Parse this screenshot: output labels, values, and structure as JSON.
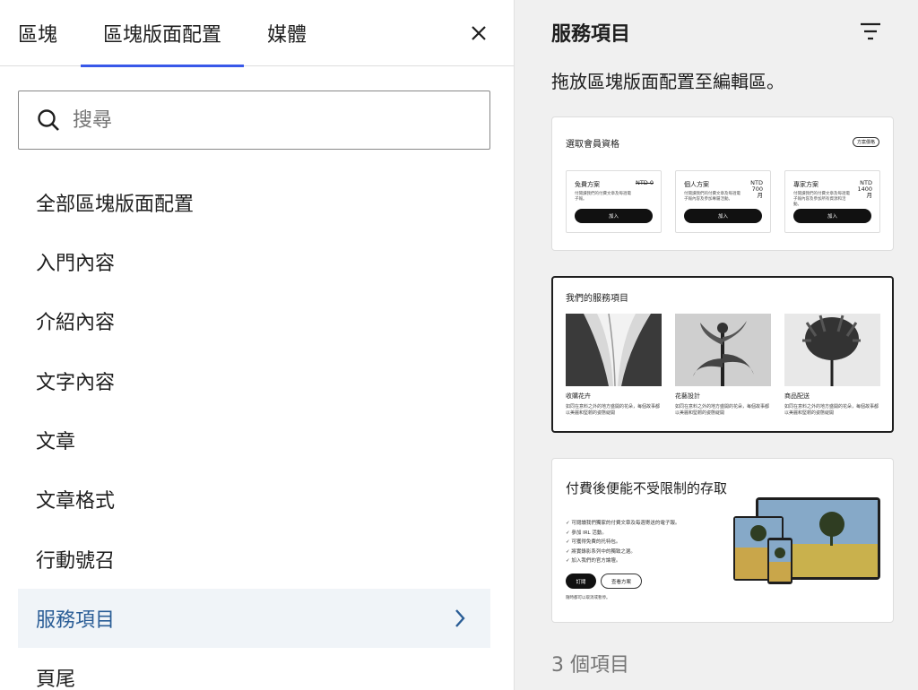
{
  "tabs": [
    "區塊",
    "區塊版面配置",
    "媒體"
  ],
  "search": {
    "placeholder": "搜尋"
  },
  "categories": [
    "全部區塊版面配置",
    "入門內容",
    "介紹內容",
    "文字內容",
    "文章",
    "文章格式",
    "行動號召",
    "服務項目",
    "頁尾"
  ],
  "panel": {
    "title": "服務項目",
    "description": "拖放區塊版面配置至編輯區。",
    "count": "3 個項目"
  },
  "pattern1": {
    "heading": "選取會員資格",
    "pill": "方案價格",
    "plans": [
      {
        "name": "免費方案",
        "price": "NTD 0",
        "desc": "付閱讀我們的付費文章及每週電子報。",
        "button": "加入"
      },
      {
        "name": "個人方案",
        "price": "NTD 700 月",
        "desc": "付閱讀我們的付費文章及每週電子報內容及參加專屬活動。",
        "button": "加入"
      },
      {
        "name": "專家方案",
        "price": "NTD 1400 月",
        "desc": "付閱讀我們的付費文章及每週電子報內容及參加所有資源和活動。",
        "button": "加入"
      }
    ]
  },
  "pattern2": {
    "heading": "我們的服務項目",
    "services": [
      {
        "title": "收購花卉",
        "desc": "如同在意料之外的地方盛開的花朵，每個故事都以美麗和堅韌的姿態綻開"
      },
      {
        "title": "花藝設計",
        "desc": "如同在意料之外的地方盛開的花朵，每個故事都以美麗和堅韌的姿態綻開"
      },
      {
        "title": "商品配送",
        "desc": "如同在意料之外的地方盛開的花朵，每個故事都以美麗和堅韌的姿態綻開"
      }
    ]
  },
  "pattern3": {
    "heading": "付費後便能不受限制的存取",
    "items": [
      "✓ 可閱讀我們獨家的付費文章及每週寄送的電子報。",
      "✓ 參加 IRL 活動。",
      "✓ 可獲得免費的托特包。",
      "✓ 將實錄影系列中的獨致之選。",
      "✓ 加入我們的官方論壇。"
    ],
    "primary_button": "訂閱",
    "secondary_button": "查看方案",
    "note": "隨時都可以取消或暫停。"
  },
  "colors": {
    "accent": "#3858e9",
    "active_text": "#2a5d96",
    "active_bg": "#f0f4f8"
  }
}
